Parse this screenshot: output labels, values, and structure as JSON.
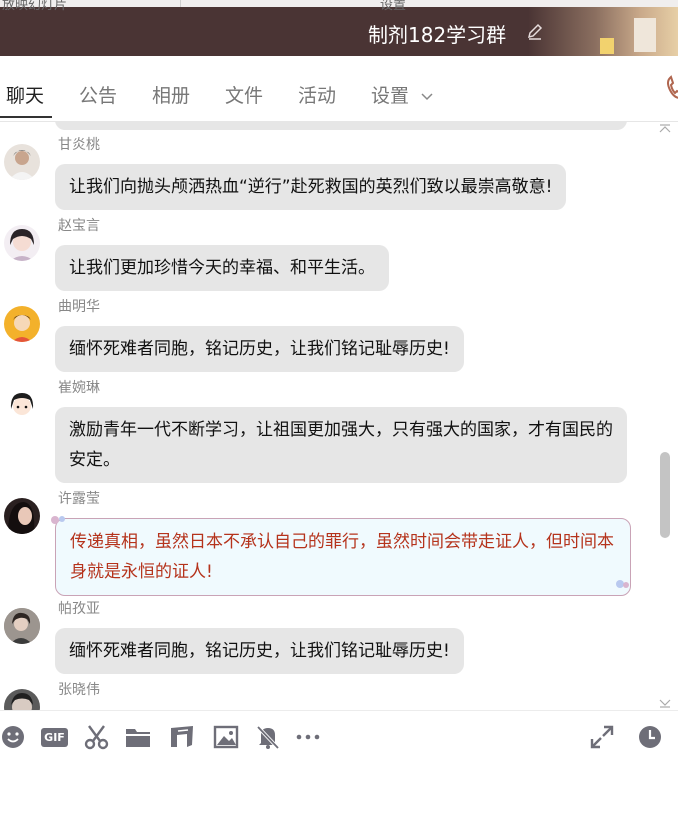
{
  "header": {
    "clipped_left": "放映幻灯片",
    "clipped_right": "设置",
    "title": "制剂182学习群"
  },
  "tabs": [
    {
      "label": "聊天",
      "active": true
    },
    {
      "label": "公告",
      "active": false
    },
    {
      "label": "相册",
      "active": false
    },
    {
      "label": "文件",
      "active": false
    },
    {
      "label": "活动",
      "active": false
    },
    {
      "label": "设置",
      "active": false
    }
  ],
  "messages": [
    {
      "sender": "甘炎桃",
      "lines": [
        "让我们向抛头颅洒热血“逆行”赴死救国的英烈们致以最崇高敬意!"
      ],
      "avatar_color": "#d9cfc8"
    },
    {
      "sender": "赵宝言",
      "lines": [
        "让我们更加珍惜今天的幸福、和平生活。"
      ],
      "avatar_color": "#3a3436"
    },
    {
      "sender": "曲明华",
      "lines": [
        "缅怀死难者同胞，铭记历史，让我们铭记耻辱历史!"
      ],
      "avatar_color": "#f3b12b"
    },
    {
      "sender": "崔婉琳",
      "lines": [
        "激励青年一代不断学习，让祖国更加强大，只有强大的国家，才有国民的",
        "安定。"
      ],
      "avatar_color": "#f4efe9"
    },
    {
      "sender": "许露莹",
      "lines": [
        "传递真相，虽然日本不承认自己的罪行，虽然时间会带走证人，但时间本",
        "身就是永恒的证人!"
      ],
      "avatar_color": "#2a2020",
      "special": true
    },
    {
      "sender": "帕孜亚",
      "lines": [
        "缅怀死难者同胞，铭记历史，让我们铭记耻辱历史!"
      ],
      "avatar_color": "#8b8580"
    },
    {
      "sender": "张晓伟",
      "lines": [],
      "avatar_color": "#5b5b5b"
    }
  ],
  "toolbar": {
    "icons": [
      "emoji-icon",
      "gif-icon",
      "scissors-icon",
      "folder-icon",
      "music-icon",
      "image-icon",
      "bell-off-icon",
      "more-icon",
      "expand-icon",
      "clock-icon"
    ],
    "gif_label": "GIF"
  },
  "colors": {
    "header_bg": "#4a3434",
    "bubble_bg": "#e6e6e6",
    "special_text": "#b5331c",
    "special_border": "#c9a3b6",
    "icon": "#6e6e78"
  }
}
